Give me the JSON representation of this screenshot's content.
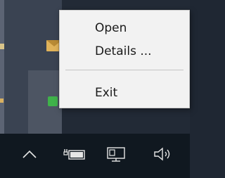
{
  "context_menu": {
    "items": [
      {
        "label": "Open"
      },
      {
        "label": "Details ..."
      },
      {
        "label": "Exit"
      }
    ]
  },
  "taskbar": {
    "icons": [
      "chevron-up-icon",
      "battery-icon",
      "network-icon",
      "volume-icon"
    ]
  },
  "colors": {
    "menu_background": "#f2f2f2",
    "taskbar_background": "#101820",
    "tray_background": "#2a3240"
  }
}
